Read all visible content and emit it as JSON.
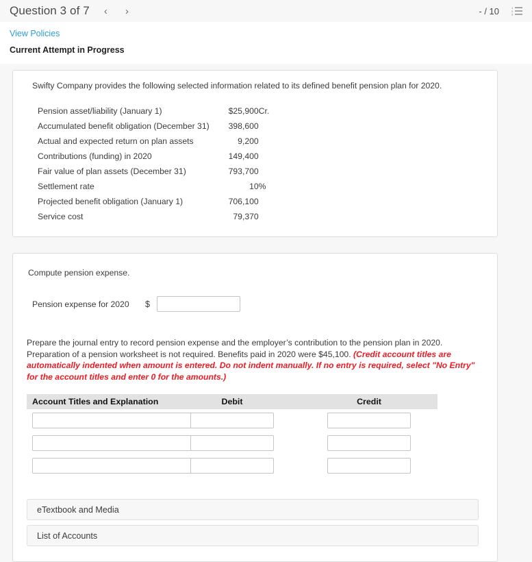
{
  "header": {
    "question_title": "Question 3 of 7",
    "prev_icon": "chevron-left-icon",
    "next_icon": "chevron-right-icon",
    "score": "- / 10",
    "list_icon": "numbered-list-icon"
  },
  "attempt": {
    "policies_link": "View Policies",
    "status": "Current Attempt in Progress"
  },
  "info_card": {
    "intro": "Swifty Company provides the following selected information related to its defined benefit pension plan for 2020.",
    "facts": [
      {
        "label": "Pension asset/liability (January 1)",
        "value": "$25,900",
        "note": "Cr."
      },
      {
        "label": "Accumulated benefit obligation (December 31)",
        "value": "398,600",
        "note": ""
      },
      {
        "label": "Actual and expected return on plan assets",
        "value": "9,200",
        "note": ""
      },
      {
        "label": "Contributions (funding) in 2020",
        "value": "149,400",
        "note": ""
      },
      {
        "label": "Fair value of plan assets (December 31)",
        "value": "793,700",
        "note": ""
      },
      {
        "label": "Settlement rate",
        "value": "10",
        "note": "%"
      },
      {
        "label": "Projected benefit obligation (January 1)",
        "value": "706,100",
        "note": ""
      },
      {
        "label": "Service cost",
        "value": "79,370",
        "note": ""
      }
    ]
  },
  "work_card": {
    "compute_title": "Compute pension expense.",
    "expense_label": "Pension expense for 2020",
    "currency_symbol": "$",
    "expense_value": "",
    "instructions_plain": "Prepare the journal entry to record pension expense and the employer’s contribution to the pension plan in 2020. Preparation of a pension worksheet is not required. Benefits paid in 2020 were $45,100. ",
    "instructions_emphasis": "(Credit account titles are automatically indented when amount is entered. Do not indent manually. If no entry is required, select \"No Entry\" for the account titles and enter 0 for the amounts.)",
    "journal": {
      "columns": [
        "Account Titles and Explanation",
        "Debit",
        "Credit"
      ],
      "rows": [
        {
          "account": "",
          "debit": "",
          "credit": ""
        },
        {
          "account": "",
          "debit": "",
          "credit": ""
        },
        {
          "account": "",
          "debit": "",
          "credit": ""
        }
      ]
    },
    "etextbook_button": "eTextbook and Media",
    "accounts_button": "List of Accounts"
  },
  "colors": {
    "link": "#2a9fd8",
    "emphasis_red": "#ed1c24",
    "page_bg": "#f7f7f7",
    "table_header_bg": "#e2e2e2"
  }
}
